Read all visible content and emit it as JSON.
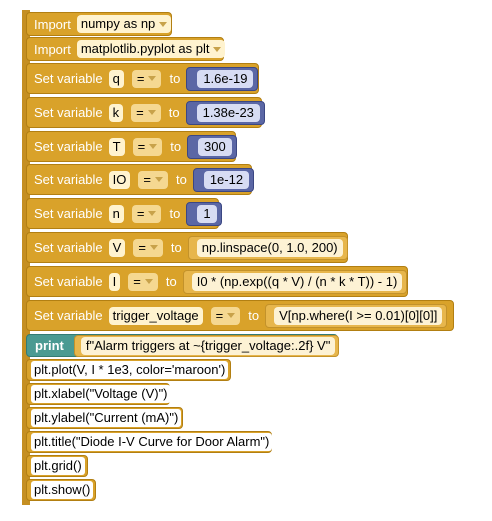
{
  "blocks": [
    {
      "kind": "import",
      "label": "Import",
      "value": "numpy as np"
    },
    {
      "kind": "import",
      "label": "Import",
      "value": "matplotlib.pyplot as plt"
    },
    {
      "kind": "set",
      "label": "Set variable",
      "var": "q",
      "op": "=",
      "to": "to",
      "value": "1.6e-19",
      "vtype": "num"
    },
    {
      "kind": "set",
      "label": "Set variable",
      "var": "k",
      "op": "=",
      "to": "to",
      "value": "1.38e-23",
      "vtype": "num"
    },
    {
      "kind": "set",
      "label": "Set variable",
      "var": "T",
      "op": "=",
      "to": "to",
      "value": "300",
      "vtype": "num"
    },
    {
      "kind": "set",
      "label": "Set variable",
      "var": "IO",
      "op": "=",
      "to": "to",
      "value": "1e-12",
      "vtype": "num"
    },
    {
      "kind": "set",
      "label": "Set variable",
      "var": "n",
      "op": "=",
      "to": "to",
      "value": "1",
      "vtype": "num"
    },
    {
      "kind": "set",
      "label": "Set variable",
      "var": "V",
      "op": "=",
      "to": "to",
      "value": "np.linspace(0, 1.0, 200)",
      "vtype": "code"
    },
    {
      "kind": "set",
      "label": "Set variable",
      "var": "I",
      "op": "=",
      "to": "to",
      "value": "I0 * (np.exp((q * V) / (n * k * T)) - 1)",
      "vtype": "code"
    },
    {
      "kind": "set",
      "label": "Set variable",
      "var": "trigger_voltage",
      "op": "=",
      "to": "to",
      "value": "V[np.where(I >= 0.01)[0][0]]",
      "vtype": "code"
    },
    {
      "kind": "print",
      "label": "print",
      "value": "f\"Alarm triggers at ~{trigger_voltage:.2f} V\""
    },
    {
      "kind": "raw",
      "value": "plt.plot(V, I * 1e3, color='maroon')"
    },
    {
      "kind": "raw",
      "value": "plt.xlabel(\"Voltage (V)\")"
    },
    {
      "kind": "raw",
      "value": "plt.ylabel(\"Current (mA)\")"
    },
    {
      "kind": "raw",
      "value": "plt.title(\"Diode I-V Curve for Door Alarm\")"
    },
    {
      "kind": "raw",
      "value": "plt.grid()"
    },
    {
      "kind": "raw",
      "value": "plt.show()"
    }
  ],
  "colors": {
    "block": "#d9a22a",
    "print": "#4a9a92",
    "number": "#5b67a5"
  }
}
